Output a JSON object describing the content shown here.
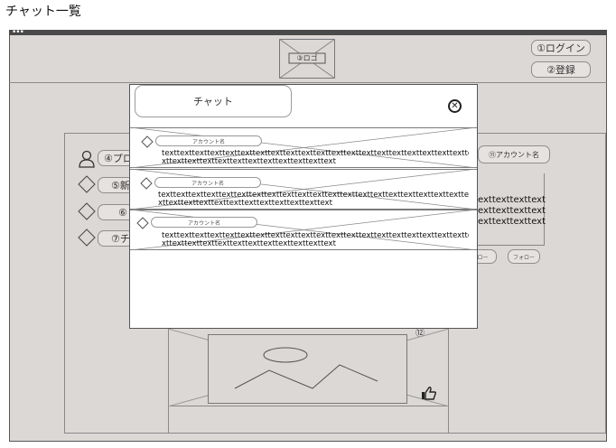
{
  "page": {
    "title": "チャット一覧"
  },
  "header": {
    "logo_label": "③ロゴ",
    "login_label": "①ログイン",
    "register_label": "②登録"
  },
  "sidebar": {
    "profile_label": "④プロ",
    "items": [
      {
        "label": "⑤新"
      },
      {
        "label": "⑥"
      },
      {
        "label": "⑦チ"
      }
    ]
  },
  "right_panel": {
    "account_label": "⑪アカウント名",
    "text_lines": [
      "exttexttexttext",
      "exttexttexttext",
      "exttexttexttext"
    ],
    "button1_label": "ロー",
    "button2_label": "フォロー"
  },
  "center": {
    "marker": "⑫"
  },
  "modal": {
    "title": "チャット",
    "chats": [
      {
        "account": "アカウント名",
        "line1": "texttexttexttexttexttexttexttexttexttexttexttexttexttexttexttexttexttexttexttextte",
        "line2": "xttexttexttexttexttexttexttexttexttexttexttext"
      },
      {
        "account": "アカウント名",
        "line1": "texttexttexttexttexttexttexttexttexttexttexttexttexttexttexttexttexttexttexttextte",
        "line2": "xttexttexttexttexttexttexttexttexttexttexttext"
      },
      {
        "account": "アカウント名",
        "line1": "texttexttexttexttexttexttexttexttexttexttexttexttexttexttexttexttexttexttexttextte",
        "line2": "xttexttexttexttexttexttexttexttexttexttexttext"
      }
    ]
  }
}
